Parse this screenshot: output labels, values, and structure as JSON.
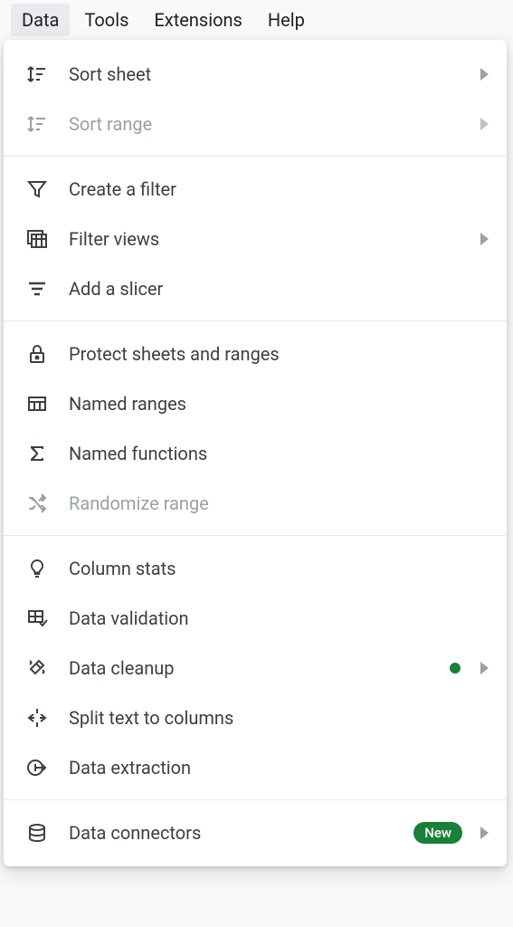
{
  "menubar": {
    "items": [
      {
        "label": "Data",
        "active": true
      },
      {
        "label": "Tools",
        "active": false
      },
      {
        "label": "Extensions",
        "active": false
      },
      {
        "label": "Help",
        "active": false
      }
    ]
  },
  "dropdown": {
    "groups": [
      [
        {
          "icon": "sort-sheet-icon",
          "label": "Sort sheet",
          "disabled": false,
          "submenu": true
        },
        {
          "icon": "sort-range-icon",
          "label": "Sort range",
          "disabled": true,
          "submenu": true
        }
      ],
      [
        {
          "icon": "filter-icon",
          "label": "Create a filter",
          "disabled": false
        },
        {
          "icon": "filter-views-icon",
          "label": "Filter views",
          "disabled": false,
          "submenu": true
        },
        {
          "icon": "slicer-icon",
          "label": "Add a slicer",
          "disabled": false
        }
      ],
      [
        {
          "icon": "lock-icon",
          "label": "Protect sheets and ranges",
          "disabled": false
        },
        {
          "icon": "named-ranges-icon",
          "label": "Named ranges",
          "disabled": false
        },
        {
          "icon": "sigma-icon",
          "label": "Named functions",
          "disabled": false
        },
        {
          "icon": "randomize-icon",
          "label": "Randomize range",
          "disabled": true
        }
      ],
      [
        {
          "icon": "bulb-icon",
          "label": "Column stats",
          "disabled": false
        },
        {
          "icon": "validation-icon",
          "label": "Data validation",
          "disabled": false
        },
        {
          "icon": "cleanup-icon",
          "label": "Data cleanup",
          "disabled": false,
          "submenu": true,
          "green_dot": true
        },
        {
          "icon": "split-icon",
          "label": "Split text to columns",
          "disabled": false
        },
        {
          "icon": "extraction-icon",
          "label": "Data extraction",
          "disabled": false
        }
      ],
      [
        {
          "icon": "database-icon",
          "label": "Data connectors",
          "disabled": false,
          "submenu": true,
          "badge": "New"
        }
      ]
    ]
  }
}
